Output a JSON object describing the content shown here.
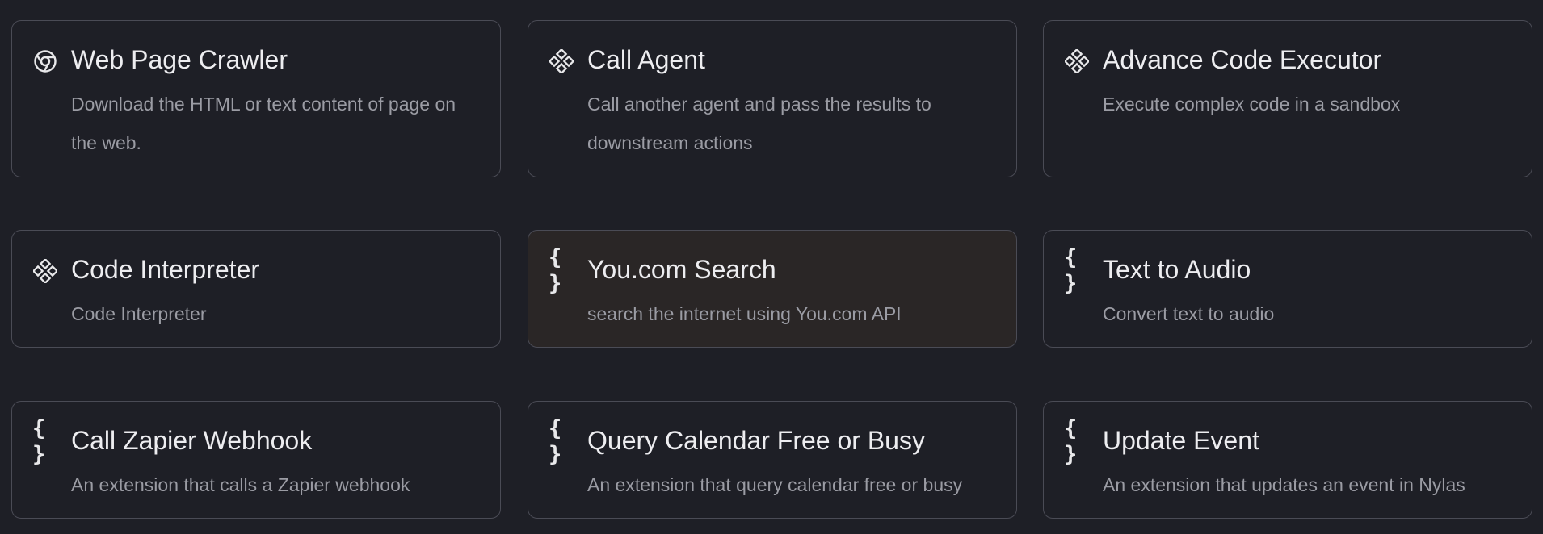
{
  "cards": [
    {
      "icon": "chrome-icon",
      "title": "Web Page Crawler",
      "description": "Download the HTML or text content of page on the web."
    },
    {
      "icon": "component-icon",
      "title": "Call Agent",
      "description": "Call another agent and pass the results to downstream actions"
    },
    {
      "icon": "component-icon",
      "title": "Advance Code Executor",
      "description": "Execute complex code in a sandbox"
    },
    {
      "icon": "component-icon",
      "title": "Code Interpreter",
      "description": "Code Interpreter"
    },
    {
      "icon": "braces-icon",
      "title": "You.com Search",
      "description": "search the internet using You.com API"
    },
    {
      "icon": "braces-icon",
      "title": "Text to Audio",
      "description": "Convert text to audio"
    },
    {
      "icon": "braces-icon",
      "title": "Call Zapier Webhook",
      "description": "An extension that calls a Zapier webhook"
    },
    {
      "icon": "braces-icon",
      "title": "Query Calendar Free or Busy",
      "description": "An extension that query calendar free or busy"
    },
    {
      "icon": "braces-icon",
      "title": "Update Event",
      "description": "An extension that updates an event in Nylas"
    }
  ],
  "braces_glyph": "{ }",
  "colors": {
    "background": "#1e1f26",
    "border": "#4a4b55",
    "highlight_card": "#2a2626",
    "title": "#ededf0",
    "description": "#9b9ca4"
  }
}
